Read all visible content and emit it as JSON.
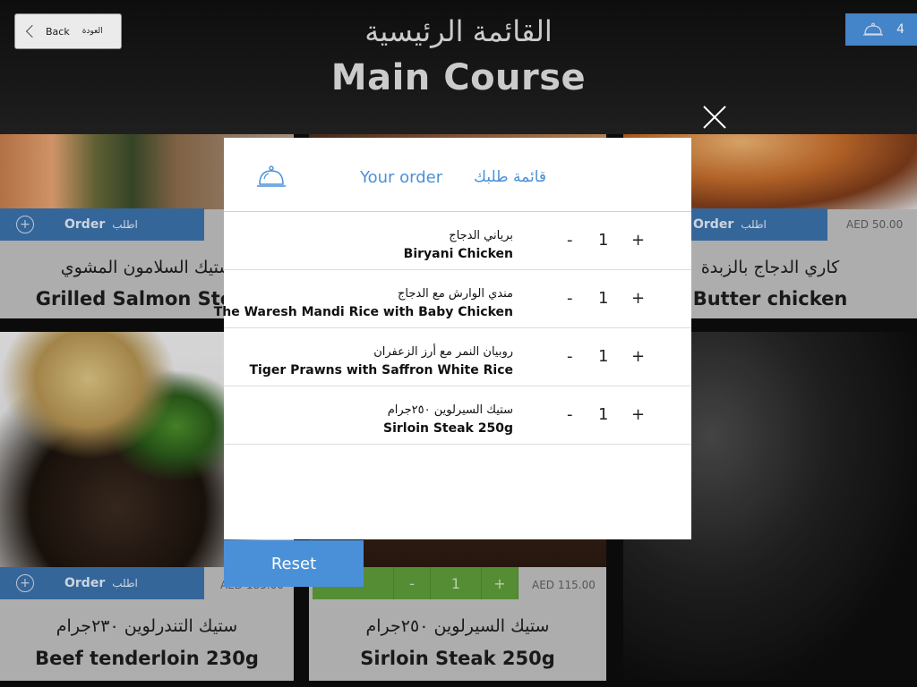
{
  "header": {
    "back_label": "Back",
    "back_label_ar": "العودة",
    "title_ar": "القائمة الرئيسية",
    "title_en": "Main Course",
    "cart_count": "4"
  },
  "cards": [
    {
      "name_ar": "ستيك السلامون المشوي",
      "name_en": "Grilled Salmon Steak",
      "order_en": "Order",
      "order_ar": "اطلب"
    },
    {
      "name_ar": "كاري الدجاج بالزبدة",
      "name_en": "Butter chicken",
      "order_en": "Order",
      "order_ar": "اطلب",
      "price": "AED 50.00"
    },
    {
      "name_ar": "ستيك التندرلوين ٢٣٠جرام",
      "name_en": "Beef tenderloin 230g",
      "order_en": "Order",
      "order_ar": "اطلب",
      "price": "AED 185.00"
    },
    {
      "name_ar": "ستيك السيرلوين ٢٥٠جرام",
      "name_en": "Sirloin Steak 250g",
      "price": "AED 115.00",
      "qty": "1",
      "minus": "-",
      "plus": "+"
    }
  ],
  "modal": {
    "title_en": "Your order",
    "title_ar": "قائمة طلبك",
    "items": [
      {
        "name_ar": "برياني الدجاج",
        "name_en": "Biryani Chicken",
        "qty": "1",
        "minus": "-",
        "plus": "+"
      },
      {
        "name_ar": "مندي الوارش مع الدجاج",
        "name_en": "The Waresh Mandi Rice with Baby Chicken",
        "qty": "1",
        "minus": "-",
        "plus": "+"
      },
      {
        "name_ar": "روبيان النمر مع أرز الزعفران",
        "name_en": "Tiger Prawns with Saffron White Rice",
        "qty": "1",
        "minus": "-",
        "plus": "+"
      },
      {
        "name_ar": "ستيك السيرلوين ٢٥٠جرام",
        "name_en": "Sirloin Steak 250g",
        "qty": "1",
        "minus": "-",
        "plus": "+"
      }
    ],
    "reset_label": "Reset"
  },
  "colors": {
    "accent": "#4a90d9",
    "order_bar": "#3a6fa8",
    "qty_green": "#5d9a3a"
  },
  "icons": {
    "cart": "food-cloche-icon",
    "back": "chevron-left-icon",
    "close": "close-icon",
    "add": "plus-circle-icon"
  }
}
